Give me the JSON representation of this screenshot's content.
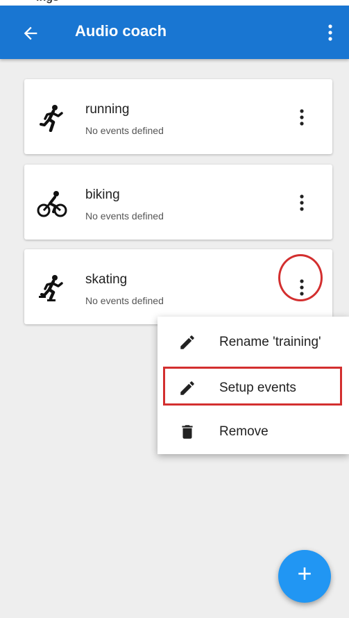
{
  "top_strip_text": "ings",
  "app_bar": {
    "title": "Audio coach",
    "back_icon": "arrow-back-icon",
    "overflow_icon": "more-vert-icon"
  },
  "profiles": [
    {
      "name": "running",
      "subtitle": "No events defined",
      "icon": "running-icon"
    },
    {
      "name": "biking",
      "subtitle": "No events defined",
      "icon": "biking-icon"
    },
    {
      "name": "skating",
      "subtitle": "No events defined",
      "icon": "skating-icon"
    }
  ],
  "context_menu": {
    "items": [
      {
        "label": "Rename 'training'",
        "icon": "pencil-icon"
      },
      {
        "label": "Setup events",
        "icon": "pencil-icon"
      },
      {
        "label": "Remove",
        "icon": "trash-icon"
      }
    ]
  },
  "fab": {
    "label": "+"
  },
  "colors": {
    "app_bar": "#1976d2",
    "fab": "#2196f3",
    "annotation": "#d32f2f",
    "background": "#eeeeee"
  }
}
